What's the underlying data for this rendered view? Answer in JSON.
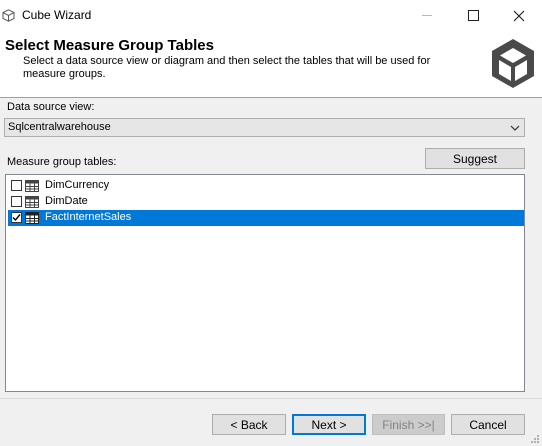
{
  "window": {
    "title": "Cube Wizard",
    "app_icon": "cube-icon",
    "controls": [
      "minimize-icon",
      "maximize-icon",
      "close-icon"
    ]
  },
  "header": {
    "title": "Select Measure Group Tables",
    "description": "Select a data source view or diagram and then select the tables that will be used for measure groups.",
    "logo": "cube-logo-icon"
  },
  "data_source": {
    "label": "Data source view:",
    "value": "Sqlcentralwarehouse"
  },
  "measure_groups": {
    "label": "Measure group tables:",
    "suggest_label": "Suggest",
    "items": [
      {
        "label": "DimCurrency",
        "checked": false,
        "selected": false,
        "icon": "table-icon"
      },
      {
        "label": "DimDate",
        "checked": false,
        "selected": false,
        "icon": "table-icon"
      },
      {
        "label": "FactInternetSales",
        "checked": true,
        "selected": true,
        "icon": "table-icon"
      }
    ]
  },
  "footer": {
    "back_label": "< Back",
    "next_label": "Next >",
    "finish_label": "Finish >>|",
    "cancel_label": "Cancel"
  },
  "colors": {
    "selection": "#0078d7",
    "logo": "#4a4a4a",
    "dialog_bg": "#f0f0f0"
  }
}
